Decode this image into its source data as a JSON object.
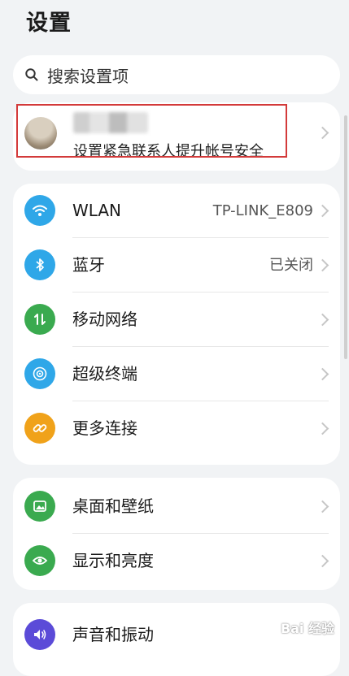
{
  "header": {
    "title": "设置"
  },
  "search": {
    "placeholder": "搜索设置项"
  },
  "account": {
    "subtitle": "设置紧急联系人提升帐号安全"
  },
  "sections": {
    "network": [
      {
        "label": "WLAN",
        "value": "TP-LINK_E809",
        "icon": "wifi-icon",
        "color": "#2fa7e8"
      },
      {
        "label": "蓝牙",
        "value": "已关闭",
        "icon": "bluetooth-icon",
        "color": "#2fa7e8"
      },
      {
        "label": "移动网络",
        "value": "",
        "icon": "mobile-network-icon",
        "color": "#3aaa4f"
      },
      {
        "label": "超级终端",
        "value": "",
        "icon": "super-device-icon",
        "color": "#2fa7e8"
      },
      {
        "label": "更多连接",
        "value": "",
        "icon": "link-icon",
        "color": "#f0a21a"
      }
    ],
    "display": [
      {
        "label": "桌面和壁纸",
        "value": "",
        "icon": "wallpaper-icon",
        "color": "#3aaa4f"
      },
      {
        "label": "显示和亮度",
        "value": "",
        "icon": "eye-icon",
        "color": "#3aaa4f"
      }
    ],
    "sound": [
      {
        "label": "声音和振动",
        "value": "",
        "icon": "sound-icon",
        "color": "#5b4bd8"
      }
    ]
  },
  "watermark": {
    "text": "Bai 经验"
  }
}
